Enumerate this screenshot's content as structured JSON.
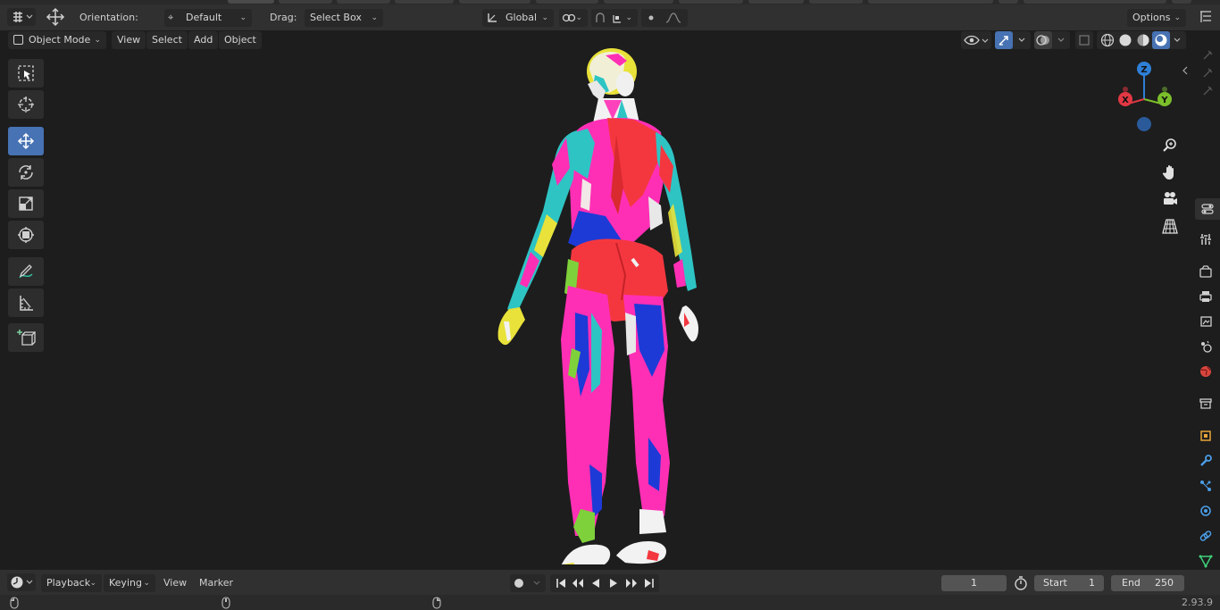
{
  "header": {
    "orientation_label": "Orientation:",
    "orientation_value": "Default",
    "drag_label": "Drag:",
    "drag_value": "Select Box",
    "transform_value": "Global",
    "options_label": "Options"
  },
  "subbar": {
    "mode": "Object Mode",
    "menus": [
      "View",
      "Select",
      "Add",
      "Object"
    ]
  },
  "gizmo": {
    "z": "Z",
    "y": "Y",
    "x": "X"
  },
  "timeline": {
    "menus": [
      "Playback",
      "Keying",
      "View",
      "Marker"
    ],
    "current_frame": "1",
    "start_label": "Start",
    "start_value": "1",
    "end_label": "End",
    "end_value": "250"
  },
  "status": {
    "version": "2.93.9"
  },
  "colors": {
    "accent": "#4772b3",
    "header": "#303030",
    "viewport": "#1d1d1d"
  },
  "icons": [
    "editor-type-icon",
    "move-gizmo-icon",
    "transform-orientation-icon",
    "pivot-icon",
    "snap-icon",
    "proportional-icon",
    "visibility-icon",
    "gizmo-icon",
    "overlay-icon",
    "xray-icon",
    "wireframe-shading-icon",
    "solid-shading-icon",
    "material-shading-icon",
    "rendered-shading-icon",
    "select-box-icon",
    "cursor-icon",
    "move-icon",
    "rotate-icon",
    "scale-icon",
    "transform-icon",
    "annotate-icon",
    "measure-icon",
    "add-cube-icon",
    "zoom-icon",
    "hand-icon",
    "camera-icon",
    "grid-icon",
    "tool-properties-icon",
    "render-properties-icon",
    "output-properties-icon",
    "view-layer-icon",
    "scene-icon",
    "world-icon",
    "collection-icon",
    "object-icon",
    "modifier-icon",
    "particles-icon",
    "physics-icon",
    "constraints-icon",
    "data-icon",
    "material-icon",
    "clock-icon"
  ]
}
